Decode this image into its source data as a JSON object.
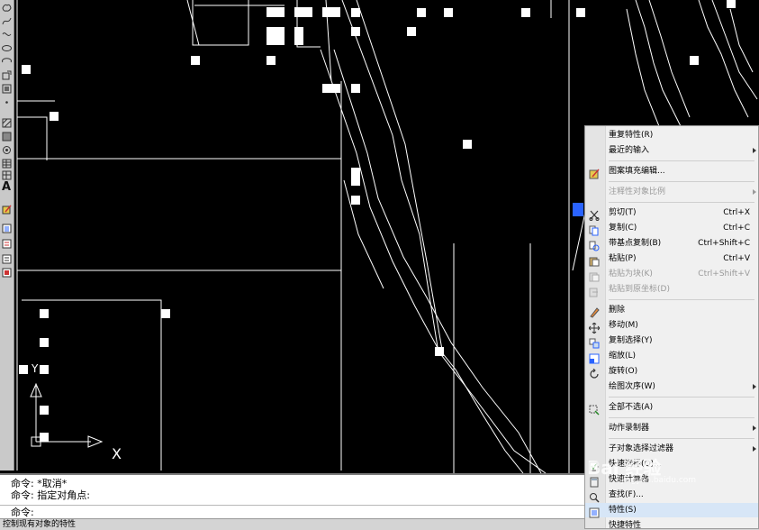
{
  "canvas": {
    "background": "#000000",
    "line_color": "#ffffff",
    "grip_color": "#2a63ff",
    "ucs_x_label": "X",
    "ucs_y_label": "Y"
  },
  "toolbar": {
    "text_tool_glyph": "A"
  },
  "command_window": {
    "line1": "命令: *取消*",
    "line2": "命令: 指定对角点:",
    "prompt": "命令:"
  },
  "status_bar": {
    "text": "控制现有对象的特性"
  },
  "context_menu": {
    "items": [
      {
        "label": "重复特性(R)",
        "shortcut": "",
        "submenu": false,
        "disabled": false,
        "icon": "none"
      },
      {
        "label": "最近的输入",
        "shortcut": "",
        "submenu": true,
        "disabled": false,
        "icon": "none"
      },
      {
        "label": "图案填充编辑...",
        "shortcut": "",
        "submenu": false,
        "disabled": false,
        "icon": "hatch-edit-icon"
      },
      {
        "label": "注释性对象比例",
        "shortcut": "",
        "submenu": true,
        "disabled": true,
        "icon": "none"
      },
      {
        "label": "剪切(T)",
        "shortcut": "Ctrl+X",
        "submenu": false,
        "disabled": false,
        "icon": "scissors-icon"
      },
      {
        "label": "复制(C)",
        "shortcut": "Ctrl+C",
        "submenu": false,
        "disabled": false,
        "icon": "copy-icon"
      },
      {
        "label": "带基点复制(B)",
        "shortcut": "Ctrl+Shift+C",
        "submenu": false,
        "disabled": false,
        "icon": "copy-base-icon"
      },
      {
        "label": "粘贴(P)",
        "shortcut": "Ctrl+V",
        "submenu": false,
        "disabled": false,
        "icon": "paste-icon"
      },
      {
        "label": "粘贴为块(K)",
        "shortcut": "Ctrl+Shift+V",
        "submenu": false,
        "disabled": true,
        "icon": "paste-block-icon"
      },
      {
        "label": "粘贴到原坐标(D)",
        "shortcut": "",
        "submenu": false,
        "disabled": true,
        "icon": "paste-orig-icon"
      },
      {
        "label": "删除",
        "shortcut": "",
        "submenu": false,
        "disabled": false,
        "icon": "eraser-icon"
      },
      {
        "label": "移动(M)",
        "shortcut": "",
        "submenu": false,
        "disabled": false,
        "icon": "move-icon"
      },
      {
        "label": "复制选择(Y)",
        "shortcut": "",
        "submenu": false,
        "disabled": false,
        "icon": "copy-select-icon"
      },
      {
        "label": "缩放(L)",
        "shortcut": "",
        "submenu": false,
        "disabled": false,
        "icon": "scale-icon"
      },
      {
        "label": "旋转(O)",
        "shortcut": "",
        "submenu": false,
        "disabled": false,
        "icon": "rotate-icon"
      },
      {
        "label": "绘图次序(W)",
        "shortcut": "",
        "submenu": true,
        "disabled": false,
        "icon": "none"
      },
      {
        "label": "全部不选(A)",
        "shortcut": "",
        "submenu": false,
        "disabled": false,
        "icon": "deselect-icon"
      },
      {
        "label": "动作录制器",
        "shortcut": "",
        "submenu": true,
        "disabled": false,
        "icon": "none"
      },
      {
        "label": "子对象选择过滤器",
        "shortcut": "",
        "submenu": true,
        "disabled": false,
        "icon": "none"
      },
      {
        "label": "快速选择(Q)...",
        "shortcut": "",
        "submenu": false,
        "disabled": false,
        "icon": "quick-select-icon"
      },
      {
        "label": "快速计算器",
        "shortcut": "",
        "submenu": false,
        "disabled": false,
        "icon": "calculator-icon"
      },
      {
        "label": "查找(F)...",
        "shortcut": "",
        "submenu": false,
        "disabled": false,
        "icon": "find-icon"
      },
      {
        "label": "特性(S)",
        "shortcut": "",
        "submenu": false,
        "disabled": false,
        "icon": "properties-icon"
      },
      {
        "label": "快捷特性",
        "shortcut": "",
        "submenu": false,
        "disabled": false,
        "icon": "none"
      }
    ]
  },
  "watermark": {
    "text": "Bai 经验",
    "sub": "jingyan.baidu.com"
  }
}
